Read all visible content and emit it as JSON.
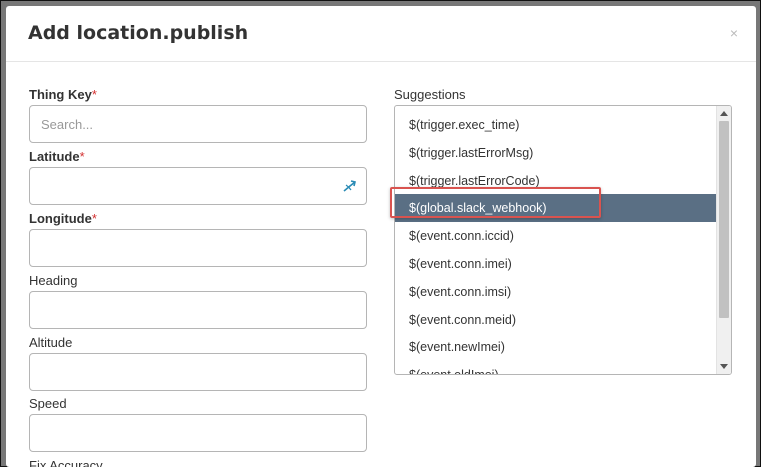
{
  "dialog": {
    "title": "Add location.publish",
    "close_glyph": "×"
  },
  "form": {
    "thing_key": {
      "label": "Thing Key",
      "required_mark": "*",
      "placeholder": "Search...",
      "value": ""
    },
    "latitude": {
      "label": "Latitude",
      "required_mark": "*",
      "value": "",
      "icon": "map-picker-icon"
    },
    "longitude": {
      "label": "Longitude",
      "required_mark": "*",
      "value": ""
    },
    "heading": {
      "label": "Heading",
      "value": ""
    },
    "altitude": {
      "label": "Altitude",
      "value": ""
    },
    "speed": {
      "label": "Speed",
      "value": ""
    },
    "fix_accuracy": {
      "label": "Fix Accuracy"
    }
  },
  "suggestions": {
    "label": "Suggestions",
    "selected_index": 3,
    "items": [
      "$(trigger.exec_time)",
      "$(trigger.lastErrorMsg)",
      "$(trigger.lastErrorCode)",
      "$(global.slack_webhook)",
      "$(event.conn.iccid)",
      "$(event.conn.imei)",
      "$(event.conn.imsi)",
      "$(event.conn.meid)",
      "$(event.newImei)",
      "$(event.oldImei)"
    ]
  },
  "colors": {
    "selected_bg": "#5a6f84",
    "highlight_border": "#d9534f",
    "required": "#d32f2f",
    "picker_icon": "#2a8bb5"
  }
}
